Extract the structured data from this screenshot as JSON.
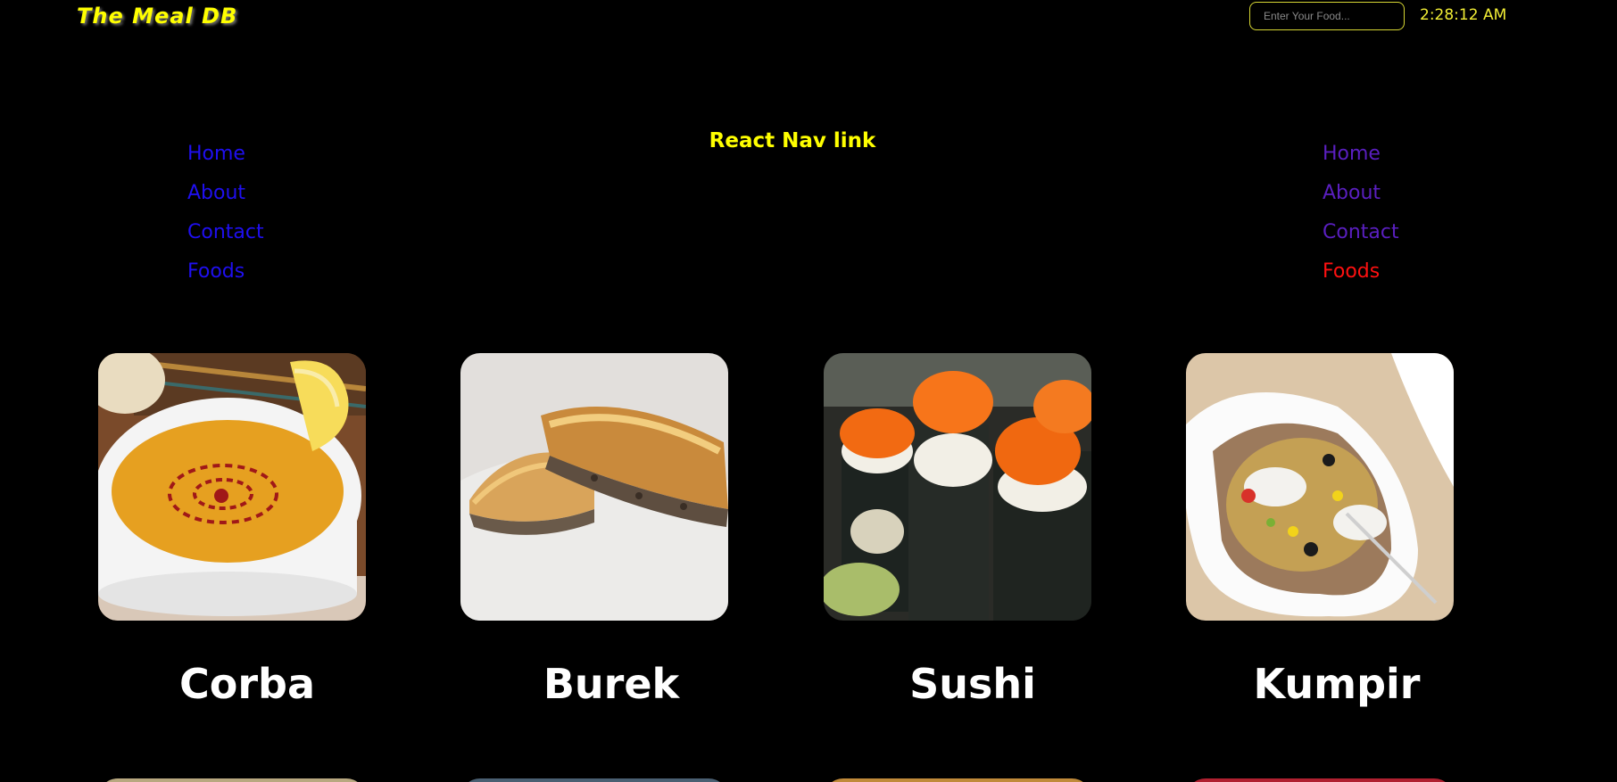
{
  "header": {
    "brand": "The Meal DB",
    "search_placeholder": "Enter Your Food...",
    "clock": "2:28:12 AM"
  },
  "nav": {
    "title": "React Nav link",
    "left_links": [
      "Home",
      "About",
      "Contact",
      "Foods"
    ],
    "right_links": [
      "Home",
      "About",
      "Contact",
      "Foods"
    ],
    "active_right": "Foods"
  },
  "meals": [
    {
      "name": "Corba",
      "image_icon": "lentil-soup-photo"
    },
    {
      "name": "Burek",
      "image_icon": "burek-pastry-photo"
    },
    {
      "name": "Sushi",
      "image_icon": "sushi-rolls-photo"
    },
    {
      "name": "Kumpir",
      "image_icon": "stuffed-potato-photo"
    }
  ],
  "colors": {
    "background": "#000000",
    "brand": "#ffff00",
    "clock": "#f2ee35",
    "nav_left": "#1f0ff0",
    "nav_right": "#5a1fc0",
    "nav_active": "#ff1010",
    "meal_title": "#ffffff"
  }
}
